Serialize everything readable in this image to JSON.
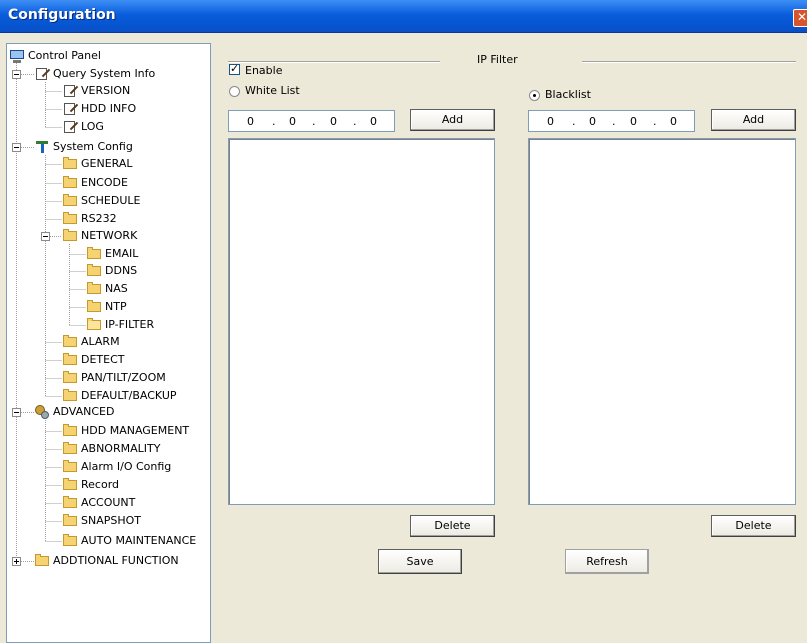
{
  "window": {
    "title": "Configuration",
    "close_glyph": "✕"
  },
  "tree": {
    "root": "Control Panel",
    "query": "Query System Info",
    "version": "VERSION",
    "hdd_info": "HDD INFO",
    "log": "LOG",
    "system_config": "System Config",
    "general": "GENERAL",
    "encode": "ENCODE",
    "schedule": "SCHEDULE",
    "rs232": "RS232",
    "network": "NETWORK",
    "email": "EMAIL",
    "ddns": "DDNS",
    "nas": "NAS",
    "ntp": "NTP",
    "ip_filter": "IP-FILTER",
    "alarm": "ALARM",
    "detect": "DETECT",
    "ptz": "PAN/TILT/ZOOM",
    "default_backup": "DEFAULT/BACKUP",
    "advanced": "ADVANCED",
    "hdd_mgmt": "HDD MANAGEMENT",
    "abnormality": "ABNORMALITY",
    "alarm_io": "Alarm I/O Config",
    "record": "Record",
    "account": "ACCOUNT",
    "snapshot": "SNAPSHOT",
    "auto_maint": "AUTO MAINTENANCE",
    "additional": "ADDTIONAL FUNCTION"
  },
  "ipfilter": {
    "group_label": "IP Filter",
    "enable_label": "Enable",
    "enable_checked": true,
    "whitelist_label": "White List",
    "blacklist_label": "Blacklist",
    "selected_mode": "Blacklist",
    "white_ip": [
      "0",
      "0",
      "0",
      "0"
    ],
    "black_ip": [
      "0",
      "0",
      "0",
      "0"
    ],
    "ip_sep": ".",
    "add_label": "Add",
    "delete_label": "Delete",
    "save_label": "Save",
    "refresh_label": "Refresh"
  }
}
